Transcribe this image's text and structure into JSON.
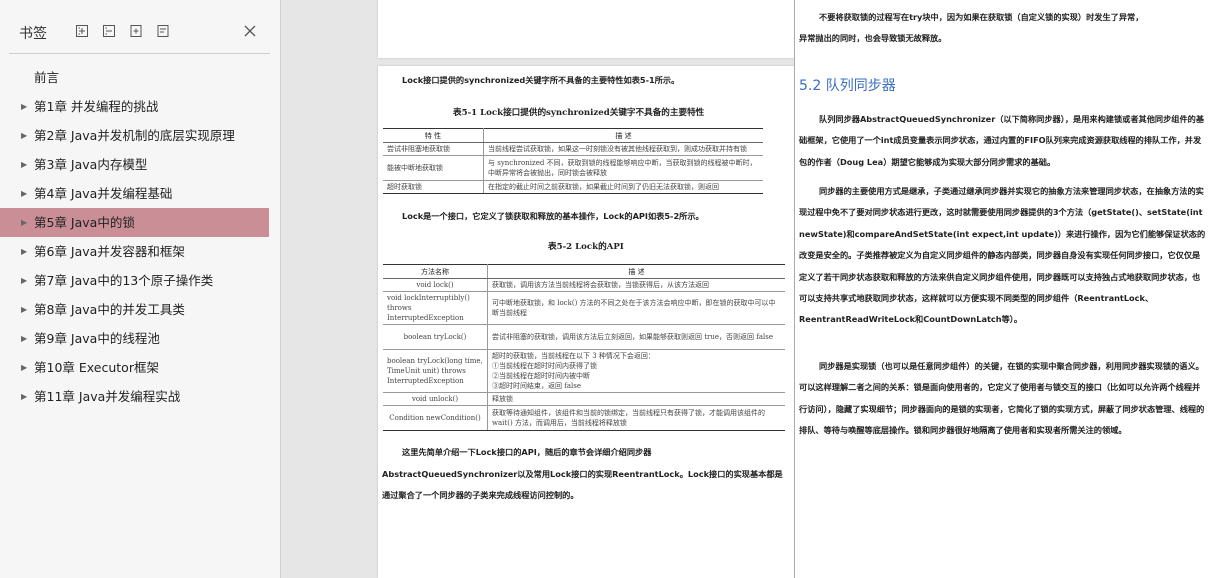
{
  "sidebar": {
    "title": "书签",
    "tools": [
      "expand-all-icon",
      "collapse-all-icon",
      "add-bookmark-icon",
      "bookmark-icon"
    ],
    "items": [
      {
        "label": "前言",
        "arrow": false,
        "active": false
      },
      {
        "label": "第1章  并发编程的挑战",
        "arrow": true,
        "active": false
      },
      {
        "label": "第2章  Java并发机制的底层实现原理",
        "arrow": true,
        "active": false
      },
      {
        "label": "第3章  Java内存模型",
        "arrow": true,
        "active": false
      },
      {
        "label": "第4章  Java并发编程基础",
        "arrow": true,
        "active": false
      },
      {
        "label": "第5章  Java中的锁",
        "arrow": true,
        "active": true
      },
      {
        "label": "第6章  Java并发容器和框架",
        "arrow": true,
        "active": false
      },
      {
        "label": "第7章  Java中的13个原子操作类",
        "arrow": true,
        "active": false
      },
      {
        "label": "第8章  Java中的并发工具类",
        "arrow": true,
        "active": false
      },
      {
        "label": "第9章  Java中的线程池",
        "arrow": true,
        "active": false
      },
      {
        "label": "第10章  Executor框架",
        "arrow": true,
        "active": false
      },
      {
        "label": "第11章  Java并发编程实战",
        "arrow": true,
        "active": false
      }
    ],
    "active_color": "#c98e96"
  },
  "left_page": {
    "intro": "Lock接口提供的synchronized关键字所不具备的主要特性如表5-1所示。",
    "table1": {
      "caption": "表5-1   Lock接口提供的synchronized关键字不具备的主要特性",
      "headers": [
        "特    性",
        "描    述"
      ],
      "rows": [
        [
          "尝试非阻塞地获取锁",
          "当前线程尝试获取锁，如果这一时刻锁没有被其他线程获取到，则成功获取并持有锁"
        ],
        [
          "能被中断地获取锁",
          "与 synchronized 不同，获取到锁的线程能够响应中断，当获取到锁的线程被中断时，中断异常将会被抛出，同时锁会被释放"
        ],
        [
          "超时获取锁",
          "在指定的截止时间之前获取锁，如果截止时间到了仍旧无法获取锁，则返回"
        ]
      ]
    },
    "mid_text": "Lock是一个接口，它定义了锁获取和释放的基本操作，Lock的API如表5-2所示。",
    "table2": {
      "caption": "表5-2   Lock的API",
      "headers": [
        "方法名称",
        "描    述"
      ],
      "rows": [
        [
          "void lock()",
          "获取锁，调用该方法当前线程将会获取锁，当锁获得后，从该方法返回"
        ],
        [
          "void lockInterruptibly() throws InterruptedException",
          "可中断地获取锁，和 lock() 方法的不同之处在于该方法会响应中断，即在锁的获取中可以中断当前线程"
        ],
        [
          "boolean tryLock()",
          "尝试非阻塞的获取锁，调用该方法后立刻返回，如果能够获取则返回 true，否则返回 false"
        ],
        [
          "boolean tryLock(long time, TimeUnit unit) throws InterruptedException",
          "超时的获取锁，当前线程在以下 3 种情况下会返回：\n①当前线程在超时时间内获得了锁\n②当前线程在超时时间内被中断\n③超时时间结束，返回 false"
        ],
        [
          "void unlock()",
          "释放锁"
        ],
        [
          "Condition newCondition()",
          "获取等待通知组件，该组件和当前的锁绑定，当前线程只有获得了锁，才能调用该组件的 wait() 方法，而调用后，当前线程将释放锁"
        ]
      ]
    },
    "outro_1": "这里先简单介绍一下Lock接口的API，随后的章节会详细介绍同步器",
    "outro_2": "AbstractQueuedSynchronizer以及常用Lock接口的实现ReentrantLock。Lock接口的实现基本都是",
    "outro_3": "通过聚合了一个同步器的子类来完成线程访问控制的。"
  },
  "right_page": {
    "top_line_1": "不要将获取锁的过程写在try块中，因为如果在获取锁（自定义锁的实现）时发生了异常，",
    "top_line_2": "异常抛出的同时，也会导致锁无故释放。",
    "section_title": "5.2  队列同步器",
    "para1": "队列同步器AbstractQueuedSynchronizer（以下简称同步器），是用来构建锁或者其他同步组件的基础框架，它使用了一个int成员变量表示同步状态，通过内置的FIFO队列来完成资源获取线程的排队工作，并发包的作者（Doug Lea）期望它能够成为实现大部分同步需求的基础。",
    "para2": "同步器的主要使用方式是继承，子类通过继承同步器并实现它的抽象方法来管理同步状态，在抽象方法的实现过程中免不了要对同步状态进行更改，这时就需要使用同步器提供的3个方法（getState()、setState(int newState)和compareAndSetState(int expect,int update)）来进行操作，因为它们能够保证状态的改变是安全的。子类推荐被定义为自定义同步组件的静态内部类，同步器自身没有实现任何同步接口，它仅仅是定义了若干同步状态获取和释放的方法来供自定义同步组件使用，同步器既可以支持独占式地获取同步状态，也可以支持共享式地获取同步状态，这样就可以方便实现不同类型的同步组件（ReentrantLock、ReentrantReadWriteLock和CountDownLatch等）。",
    "para3": "同步器是实现锁（也可以是任意同步组件）的关键，在锁的实现中聚合同步器，利用同步器实现锁的语义。可以这样理解二者之间的关系：锁是面向使用者的，它定义了使用者与锁交互的接口（比如可以允许两个线程并行访问），隐藏了实现细节；同步器面向的是锁的实现者，它简化了锁的实现方式，屏蔽了同步状态管理、线程的排队、等待与唤醒等底层操作。锁和同步器很好地隔离了使用者和实现者所需关注的领域。",
    "section_color": "#3a6cc4"
  }
}
